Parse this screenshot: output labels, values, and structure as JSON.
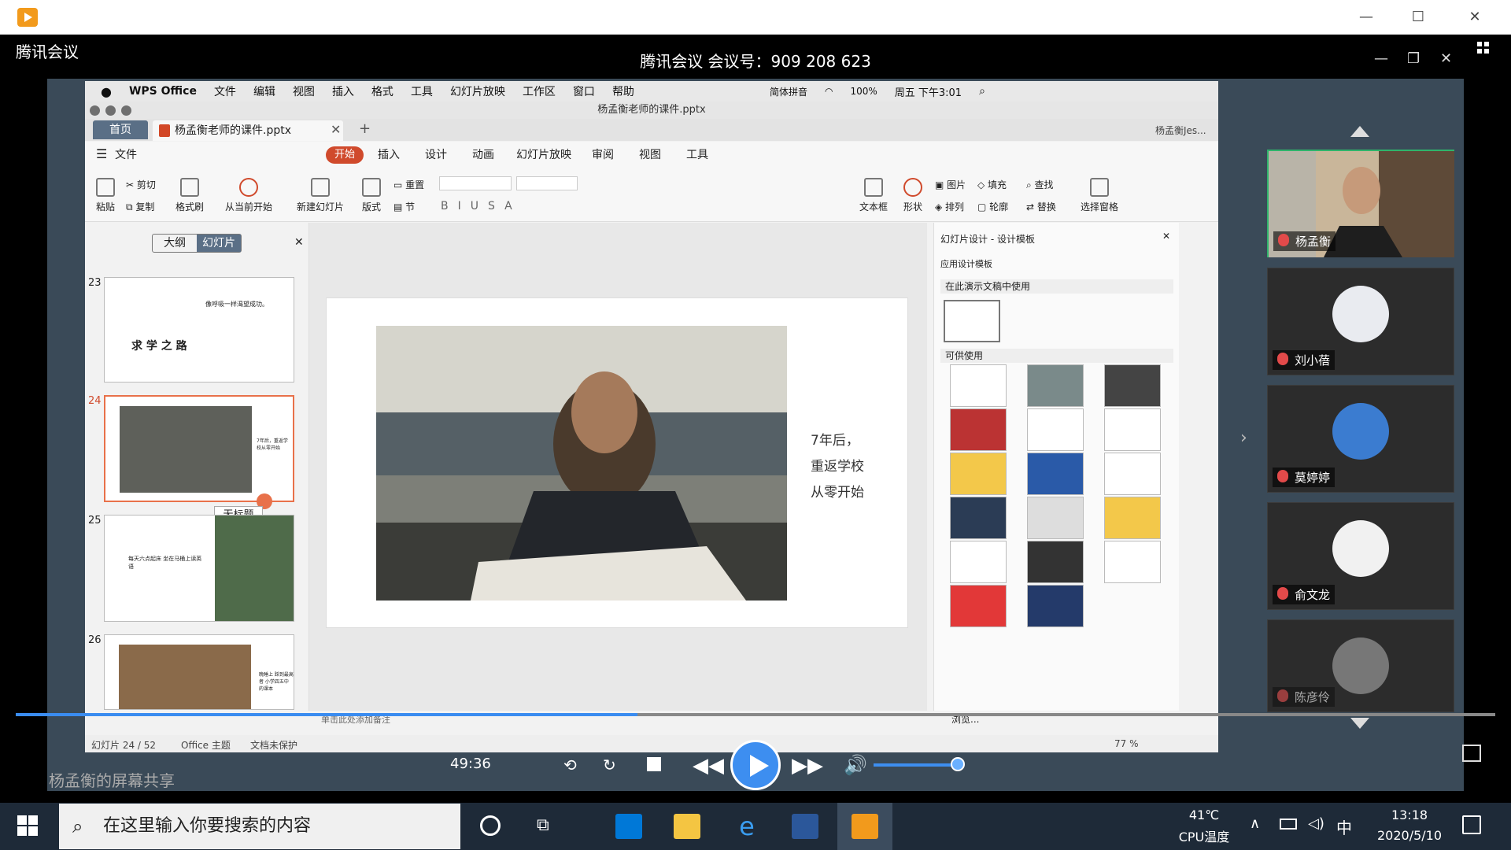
{
  "player": {
    "app_icon": "tencent-video-icon",
    "min": "—",
    "max": "☐",
    "close": "✕"
  },
  "meeting": {
    "app_label": "腾讯会议",
    "title": "腾讯会议 会议号：909 208 623",
    "share_label": "杨孟衡的屏幕共享"
  },
  "mac_menu": {
    "apple": "",
    "items": [
      "WPS Office",
      "文件",
      "编辑",
      "视图",
      "插入",
      "格式",
      "工具",
      "幻灯片放映",
      "工作区",
      "窗口",
      "帮助"
    ],
    "ime": "简体拼音",
    "battery": "100%",
    "clock": "周五 下午3:01"
  },
  "wps": {
    "window_title": "杨孟衡老师的课件.pptx",
    "home_tab": "首页",
    "doc_tab": "杨孟衡老师的课件.pptx",
    "user": "杨孟衡Jes...",
    "menu_label": "文件",
    "ribbon_tabs": [
      "开始",
      "插入",
      "设计",
      "动画",
      "幻灯片放映",
      "审阅",
      "视图",
      "工具"
    ],
    "toolbar": {
      "paste": "粘贴",
      "cut": "剪切",
      "copy": "复制",
      "format_painter": "格式刷",
      "play_from_current": "从当前开始",
      "new_slide": "新建幻灯片",
      "layout": "版式",
      "reset": "重置",
      "section": "节",
      "textbox": "文本框",
      "shape": "形状",
      "picture": "图片",
      "fill": "填充",
      "arrange": "排列",
      "outline": "轮廓",
      "find": "查找",
      "replace": "替换",
      "select_pane": "选择窗格"
    },
    "panel_tabs": {
      "outline": "大纲",
      "slides": "幻灯片"
    },
    "slides": [
      {
        "num": "23",
        "line1": "像呼吸一样渴望成功。",
        "line2": "求 学 之 路"
      },
      {
        "num": "24",
        "text": "7年后，重返学校从零开始",
        "tooltip": "无标题"
      },
      {
        "num": "25",
        "text": "每天六点起床 坐在马桶上读英语"
      },
      {
        "num": "26",
        "text": "晚睡上 踩到最高者 小学四五中 的课本"
      }
    ],
    "current_slide": {
      "line1": "7年后，",
      "line2": "重返学校",
      "line3": "从零开始"
    },
    "notes_placeholder": "单击此处添加备注",
    "design_panel": {
      "title": "幻灯片设计 - 设计模板",
      "subtitle": "应用设计模板",
      "in_use": "在此演示文稿中使用",
      "available": "可供使用",
      "browse": "浏览..."
    },
    "status": {
      "slide_count": "幻灯片 24 / 52",
      "theme": "Office 主题",
      "protect": "文档未保护",
      "zoom": "77 %"
    }
  },
  "participants": [
    {
      "name": "杨孟衡"
    },
    {
      "name": "刘小蓓"
    },
    {
      "name": "莫婷婷"
    },
    {
      "name": "俞文龙"
    },
    {
      "name": "陈彦伶"
    }
  ],
  "playback": {
    "time": "49:36",
    "progress": 0.42
  },
  "taskbar": {
    "search_placeholder": "在这里输入你要搜索的内容",
    "temperature": "41℃",
    "temp_label": "CPU温度",
    "ime": "中",
    "time": "13:18",
    "date": "2020/5/10"
  }
}
